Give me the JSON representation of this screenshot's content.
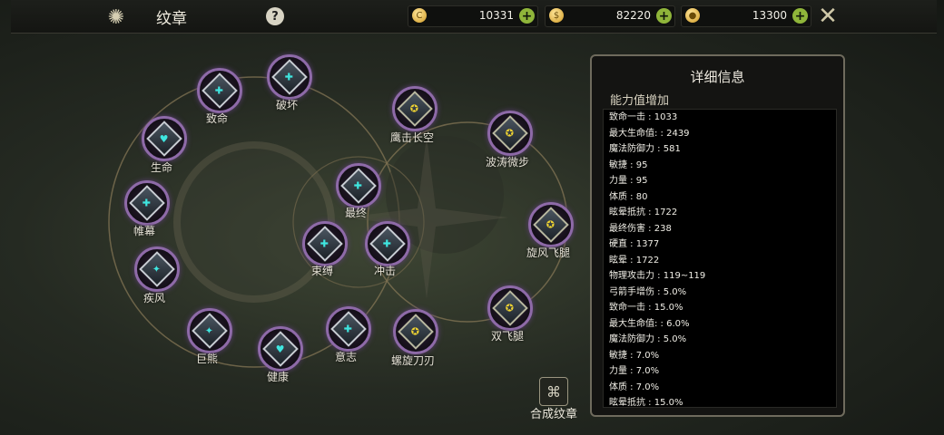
{
  "header": {
    "title": "纹章",
    "help_label": "?",
    "currencies": [
      {
        "name": "gold-coin-icon",
        "glyph": "C",
        "value": "10331"
      },
      {
        "name": "coin-bag-icon",
        "glyph": "$",
        "value": "82220"
      },
      {
        "name": "gem-coin-icon",
        "glyph": "●",
        "value": "13300"
      }
    ],
    "add_label": "+",
    "close_icon": "crossed-swords-icon"
  },
  "emblems": [
    {
      "label": "致命",
      "type": "cyan"
    },
    {
      "label": "破坏",
      "type": "cyan"
    },
    {
      "label": "生命",
      "type": "cyan"
    },
    {
      "label": "帷幕",
      "type": "cyan"
    },
    {
      "label": "疾风",
      "type": "cyan"
    },
    {
      "label": "巨熊",
      "type": "cyan"
    },
    {
      "label": "健康",
      "type": "cyan"
    },
    {
      "label": "意志",
      "type": "cyan"
    },
    {
      "label": "螺旋刀刃",
      "type": "gold"
    },
    {
      "label": "双飞腿",
      "type": "gold"
    },
    {
      "label": "旋风飞腿",
      "type": "gold"
    },
    {
      "label": "波涛微步",
      "type": "gold"
    },
    {
      "label": "鹰击长空",
      "type": "gold"
    },
    {
      "label": "最终",
      "type": "cyan"
    },
    {
      "label": "束缚",
      "type": "cyan"
    },
    {
      "label": "冲击",
      "type": "cyan"
    }
  ],
  "synthesis": {
    "label": "合成纹章",
    "icon": "synthesis-icon"
  },
  "details": {
    "title": "详细信息",
    "section": "能力值增加",
    "stats": [
      "致命一击 : 1033",
      "最大生命值: : 2439",
      "魔法防御力 : 581",
      "敏捷 : 95",
      "力量 : 95",
      "体质 : 80",
      "眩晕抵抗 : 1722",
      "最终伤害 : 238",
      "硬直 : 1377",
      "眩晕 : 1722",
      "物理攻击力 : 119~119",
      "弓箭手增伤 : 5.0%",
      "致命一击 : 15.0%",
      "最大生命值: : 6.0%",
      "魔法防御力 : 5.0%",
      "敏捷 : 7.0%",
      "力量 : 7.0%",
      "体质 : 7.0%",
      "眩晕抵抗 : 15.0%"
    ]
  }
}
